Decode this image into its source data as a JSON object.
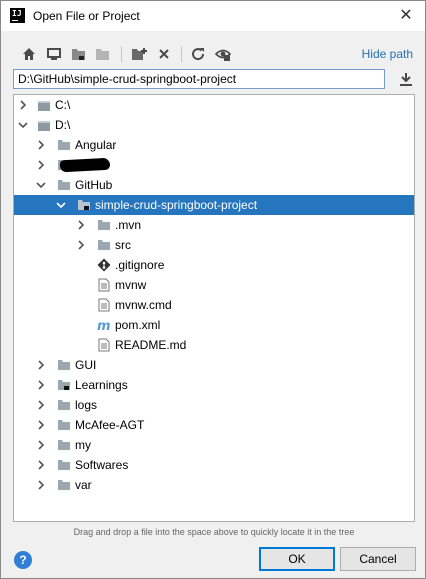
{
  "window": {
    "title": "Open File or Project",
    "app_icon_text": "IJ"
  },
  "toolbar": {
    "buttons": [
      "home-icon",
      "desktop-icon",
      "project-folder-icon",
      "module-folder-icon",
      "new-folder-icon",
      "delete-icon",
      "refresh-icon",
      "show-hidden-icon"
    ],
    "hide_path_label": "Hide path"
  },
  "path": {
    "value": "D:\\GitHub\\simple-crud-springboot-project"
  },
  "tree": {
    "rows": [
      {
        "label": "C:\\",
        "icon": "drive-icon",
        "chevron": "right"
      },
      {
        "label": "D:\\",
        "icon": "drive-icon",
        "chevron": "down"
      },
      {
        "label": "Angular",
        "icon": "folder-icon",
        "chevron": "right"
      },
      {
        "label": "",
        "icon": "folder-icon",
        "chevron": "right"
      },
      {
        "label": "GitHub",
        "icon": "folder-icon",
        "chevron": "down"
      },
      {
        "label": "simple-crud-springboot-project",
        "icon": "project-folder-icon",
        "chevron": "down"
      },
      {
        "label": ".mvn",
        "icon": "folder-icon",
        "chevron": "right"
      },
      {
        "label": "src",
        "icon": "folder-icon",
        "chevron": "right"
      },
      {
        "label": ".gitignore",
        "icon": "git-icon",
        "chevron": ""
      },
      {
        "label": "mvnw",
        "icon": "file-icon",
        "chevron": ""
      },
      {
        "label": "mvnw.cmd",
        "icon": "file-icon",
        "chevron": ""
      },
      {
        "label": "pom.xml",
        "icon": "maven-icon",
        "chevron": ""
      },
      {
        "label": "README.md",
        "icon": "file-icon",
        "chevron": ""
      },
      {
        "label": "GUI",
        "icon": "folder-icon",
        "chevron": "right"
      },
      {
        "label": "Learnings",
        "icon": "project-folder-icon",
        "chevron": "right"
      },
      {
        "label": "logs",
        "icon": "folder-icon",
        "chevron": "right"
      },
      {
        "label": "McAfee-AGT",
        "icon": "folder-icon",
        "chevron": "right"
      },
      {
        "label": "my",
        "icon": "folder-icon",
        "chevron": "right"
      },
      {
        "label": "Softwares",
        "icon": "folder-icon",
        "chevron": "right"
      },
      {
        "label": "var",
        "icon": "folder-icon",
        "chevron": "right"
      }
    ]
  },
  "hint": "Drag and drop a file into the space above to quickly locate it in the tree",
  "buttons": {
    "help": "?",
    "ok": "OK",
    "cancel": "Cancel"
  },
  "colors": {
    "selection": "#2675bf",
    "link": "#2470b3",
    "folder": "#9aa7b0",
    "maven": "#5b9bd5"
  }
}
